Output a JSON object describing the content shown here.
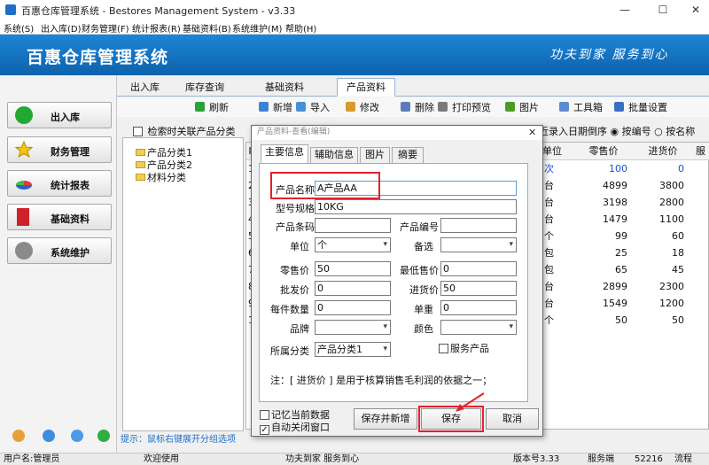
{
  "window": {
    "title": "百惠仓库管理系统 - Bestores Management System - v3.33"
  },
  "menu": [
    "系统(S)",
    "出入库(D)",
    "财务管理(F)",
    "统计报表(R)",
    "基础资料(B)",
    "系统维护(M)",
    "帮助(H)"
  ],
  "banner": {
    "title": "百惠仓库管理系统",
    "slogan": "功夫到家 服务到心"
  },
  "sidebar": {
    "items": [
      "出入库",
      "财务管理",
      "统计报表",
      "基础资料",
      "系统维护"
    ]
  },
  "main_tabs": [
    "出入库",
    "库存查询",
    "基础资料",
    "产品资料"
  ],
  "toolbar": [
    "刷新",
    "新增",
    "导入",
    "修改",
    "删除",
    "打印预览",
    "图片",
    "工具箱",
    "批量设置"
  ],
  "tree": {
    "checkbox_label": "检索时关联产品分类",
    "items": [
      "产品分类1",
      "产品分类2",
      "材料分类"
    ]
  },
  "sort": {
    "label": "近录入日期倒序",
    "by_code": "按编号",
    "by_name": "按名称"
  },
  "grid": {
    "headers": [
      "单位",
      "零售价",
      "进货价",
      "服"
    ],
    "rows": [
      [
        "次",
        "100",
        "0"
      ],
      [
        "台",
        "4899",
        "3800"
      ],
      [
        "台",
        "3198",
        "2800"
      ],
      [
        "台",
        "1479",
        "1100"
      ],
      [
        "个",
        "99",
        "60"
      ],
      [
        "包",
        "25",
        "18"
      ],
      [
        "包",
        "65",
        "45"
      ],
      [
        "台",
        "2899",
        "2300"
      ],
      [
        "台",
        "1549",
        "1200"
      ],
      [
        "个",
        "50",
        "50"
      ]
    ],
    "row_numbers": [
      "1",
      "2",
      "3",
      "4",
      "5",
      "6",
      "7",
      "8",
      "9",
      "10"
    ],
    "col_label": "Ic"
  },
  "hint": "提示：鼠标右键展开分组选项",
  "status": {
    "user": "用户名:管理员",
    "welcome": "欢迎使用",
    "slogan": "功夫到家 服务到心",
    "version": "版本号3.33",
    "server": "服务端",
    "port": "52216",
    "flow": "流程"
  },
  "dialog": {
    "title": "产品资料-查看(编辑)",
    "tabs": [
      "主要信息",
      "辅助信息",
      "图片",
      "摘要"
    ],
    "fields": {
      "name_label": "产品名称",
      "name_value": "A产品AA",
      "spec_label": "型号规格",
      "spec_value": "10KG",
      "barcode_label": "产品条码",
      "barcode_value": "",
      "code_label": "产品编号",
      "code_value": "",
      "unit_label": "单位",
      "unit_value": "个",
      "spare_label": "备选",
      "spare_value": "",
      "retail_label": "零售价",
      "retail_value": "50",
      "min_price_label": "最低售价",
      "min_price_value": "0",
      "wholesale_label": "批发价",
      "wholesale_value": "0",
      "purchase_label": "进货价",
      "purchase_value": "50",
      "per_qty_label": "每件数量",
      "per_qty_value": "0",
      "weight_label": "单重",
      "weight_value": "0",
      "brand_label": "品牌",
      "brand_value": "",
      "color_label": "颜色",
      "color_value": "",
      "category_label": "所属分类",
      "category_value": "产品分类1",
      "service_label": "服务产品"
    },
    "note": "注：[ 进货价 ] 是用于核算销售毛利润的依据之一；",
    "remember_label": "记忆当前数据",
    "auto_close_label": "自动关闭窗口",
    "btn_save_new": "保存并新增",
    "btn_save": "保存",
    "btn_cancel": "取消"
  }
}
